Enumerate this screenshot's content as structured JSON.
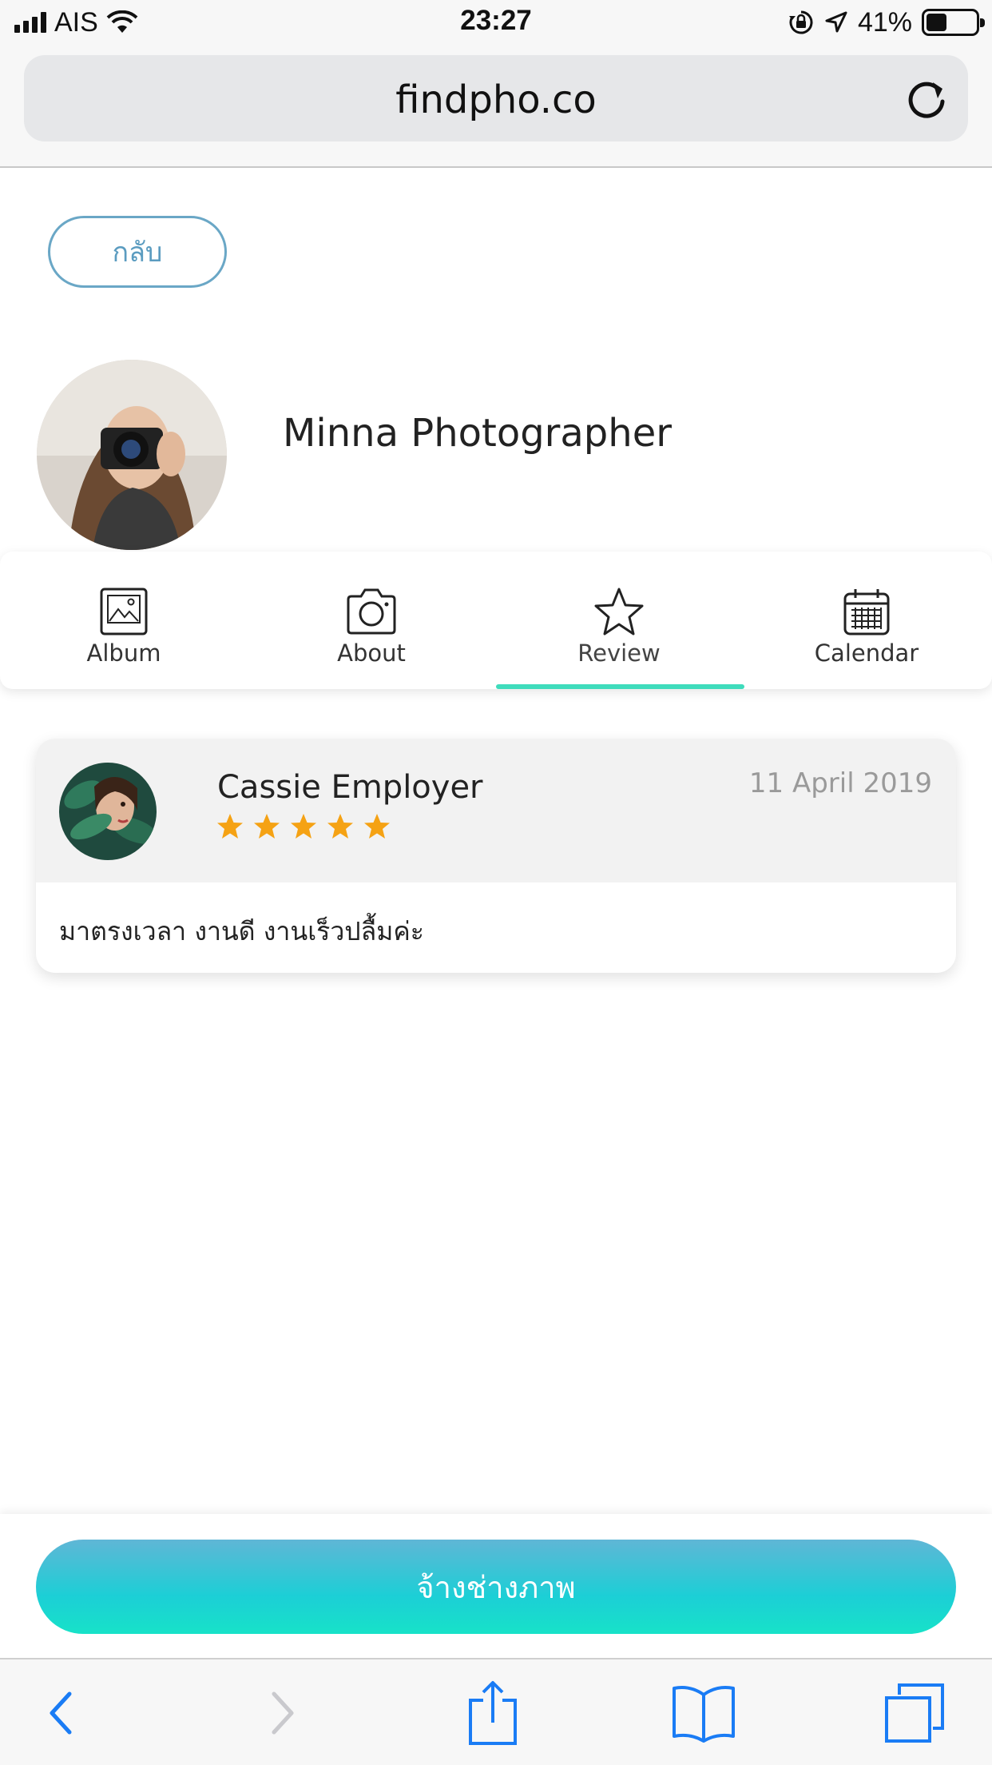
{
  "status_bar": {
    "carrier": "AIS",
    "time": "23:27",
    "battery_percent_label": "41%",
    "battery_level": 0.41,
    "icons": [
      "signal-icon",
      "wifi-icon",
      "rotation-lock-icon",
      "location-icon",
      "battery-icon"
    ]
  },
  "browser": {
    "url": "findpho.co",
    "reload_icon": "reload-icon"
  },
  "page": {
    "back_label": "กลับ",
    "profile": {
      "name": "Minna Photographer",
      "avatar_icon": "photographer-avatar"
    },
    "tabs": [
      {
        "label": "Album",
        "icon": "album-icon"
      },
      {
        "label": "About",
        "icon": "camera-icon"
      },
      {
        "label": "Review",
        "icon": "star-icon"
      },
      {
        "label": "Calendar",
        "icon": "calendar-icon"
      }
    ],
    "active_tab": "Review",
    "reviews": [
      {
        "reviewer": "Cassie Employer",
        "date": "11 April 2019",
        "rating": 5,
        "text": "มาตรงเวลา งานดี งานเร็วปลื้มค่ะ"
      }
    ],
    "hire_button_label": "จ้างช่างภาพ"
  },
  "colors": {
    "accent_teal": "#3fdcbc",
    "back_button_border": "#6aa7c6",
    "star": "#f5a214",
    "ios_blue": "#1a7cf5"
  },
  "toolbar": {
    "icons": [
      "back-arrow-icon",
      "forward-arrow-icon",
      "share-icon",
      "bookmarks-icon",
      "tabs-icon"
    ]
  }
}
